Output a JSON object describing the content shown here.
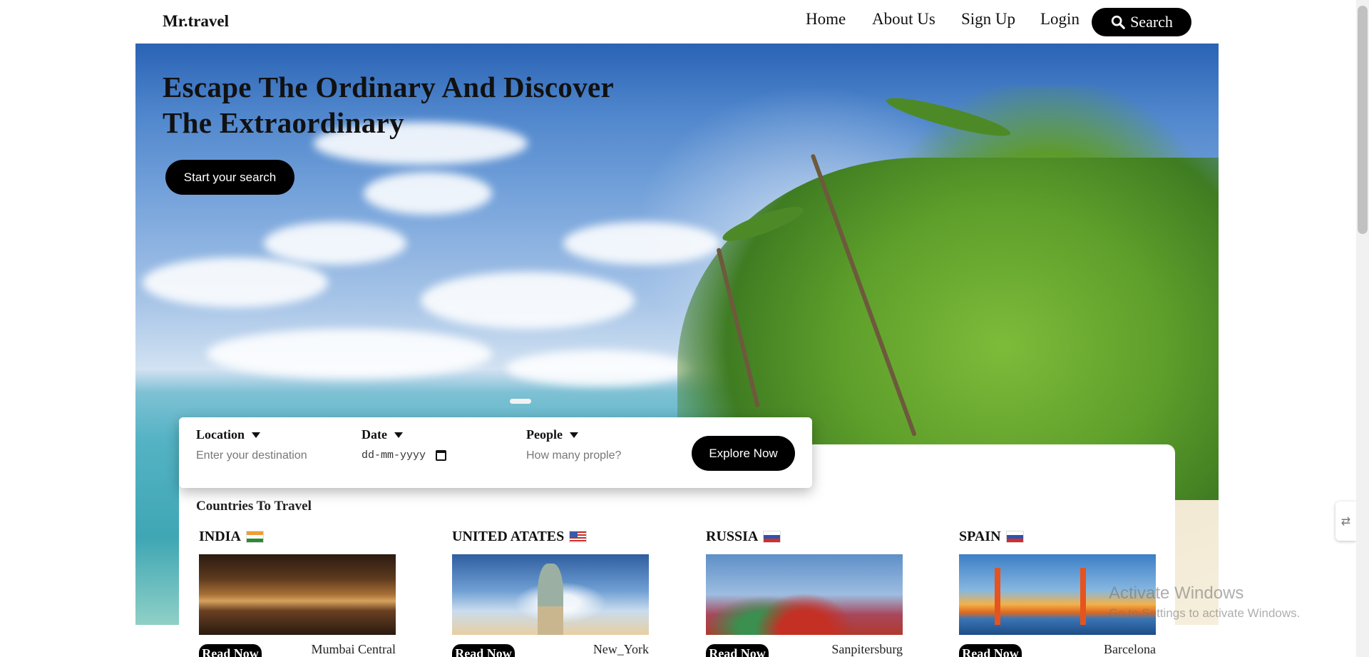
{
  "header": {
    "logo": "Mr.travel",
    "nav": [
      {
        "label": "Home"
      },
      {
        "label": "About Us"
      },
      {
        "label": "Sign Up"
      },
      {
        "label": "Login"
      }
    ],
    "search_label": "Search",
    "search_icon": "search-icon"
  },
  "hero": {
    "title": "Escape The Ordinary And Discover The Extraordinary",
    "cta_label": "Start your search"
  },
  "search_form": {
    "location": {
      "label": "Location",
      "placeholder": "Enter your destination"
    },
    "date": {
      "label": "Date",
      "placeholder": "dd-mm-yyyy"
    },
    "people": {
      "label": "People",
      "placeholder": "How many prople?"
    },
    "submit_label": "Explore Now"
  },
  "countries_section": {
    "title": "Countries To Travel",
    "items": [
      {
        "name": "INDIA",
        "flag": "india-flag-icon",
        "city": "Mumbai Central",
        "read_label": "Read Now"
      },
      {
        "name": "UNITED ATATES",
        "flag": "usa-flag-icon",
        "city": "New_York",
        "read_label": "Read Now"
      },
      {
        "name": "RUSSIA",
        "flag": "russia-flag-icon",
        "city": "Sanpitersburg",
        "read_label": "Read Now"
      },
      {
        "name": "SPAIN",
        "flag": "russia-flag-icon",
        "city": "Barcelona",
        "read_label": "Read Now"
      }
    ]
  },
  "watermark": {
    "line1": "Activate Windows",
    "line2": "Go to Settings to activate Windows."
  },
  "colors": {
    "primary_button": "#000000",
    "button_text": "#ffffff",
    "text": "#111111"
  }
}
